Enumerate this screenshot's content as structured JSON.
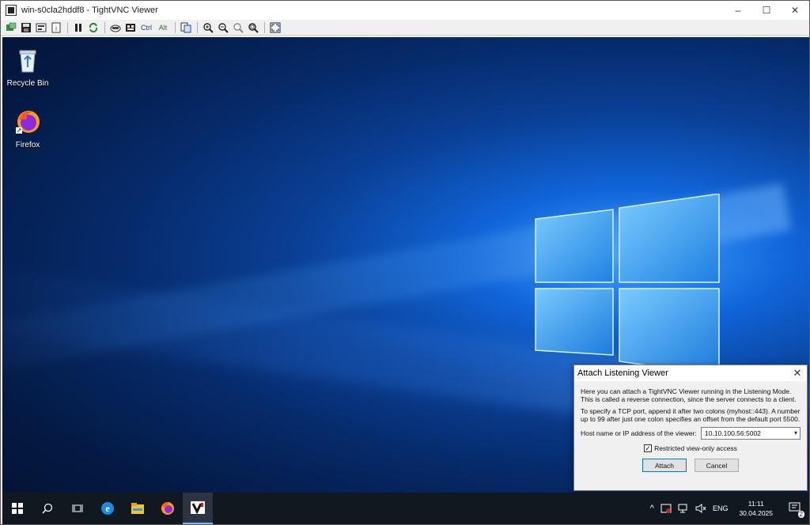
{
  "window": {
    "title": "win-s0cla2hddf8 - TightVNC Viewer",
    "controls": {
      "minimize": "–",
      "maximize": "☐",
      "close": "✕"
    }
  },
  "toolbar": {
    "ctrl_label": "Ctrl",
    "alt_label": "Alt"
  },
  "desktop": {
    "icons": [
      {
        "label": "Recycle Bin"
      },
      {
        "label": "Firefox"
      }
    ]
  },
  "dialog": {
    "title": "Attach Listening Viewer",
    "close": "✕",
    "text1": "Here you can attach a TightVNC Viewer running in the Listening Mode. This is called a reverse connection, since the server connects to a client.",
    "text2": "To specify a TCP port, append it after two colons (myhost::443).  A number up to 99 after just one colon specifies an offset from the default port 5500.",
    "host_label": "Host name or IP address of the viewer:",
    "host_value": "10.10.100.56:5002",
    "restricted_label": "Restricted view-only access",
    "restricted_checked": true,
    "attach_label": "Attach",
    "cancel_label": "Cancel"
  },
  "taskbar": {
    "language": "ENG",
    "time": "11:11",
    "date": "30.04.2025",
    "notification_count": "2"
  },
  "colors": {
    "accent": "#0078d7",
    "taskbar": "#101820"
  }
}
